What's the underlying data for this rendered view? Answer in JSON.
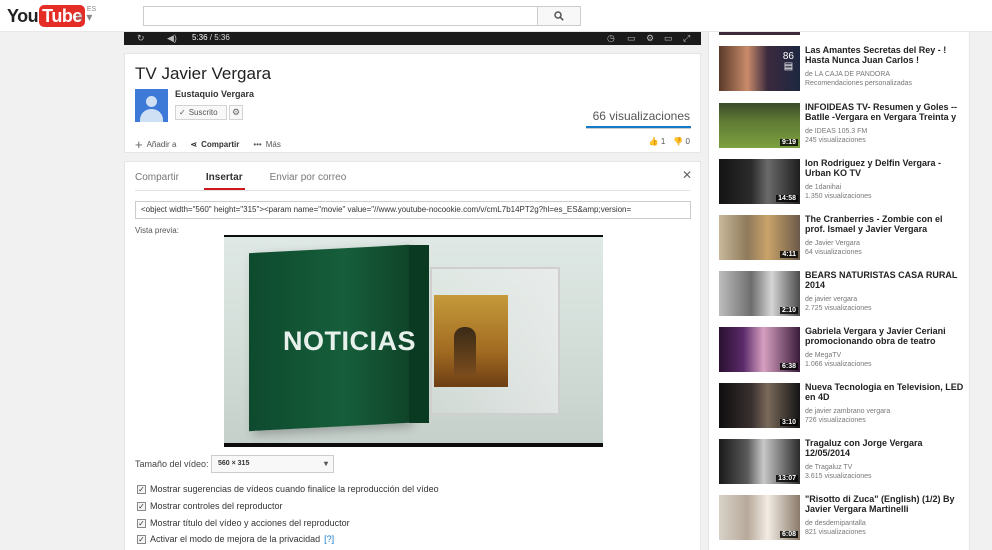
{
  "header": {
    "logo_you": "You",
    "logo_tube": "Tube",
    "logo_country": "ES"
  },
  "player": {
    "time_current": "5:36",
    "time_total": " / 5:36"
  },
  "video": {
    "title": "TV Javier Vergara",
    "channel": "Eustaquio Vergara",
    "subscribe_label": "Suscrito",
    "views": "66 visualizaciones",
    "actions": {
      "add_to": "Añadir a",
      "share": "Compartir",
      "more": "Más"
    },
    "likes": "1",
    "dislikes": "0"
  },
  "share_panel": {
    "tabs": [
      "Compartir",
      "Insertar",
      "Enviar por correo"
    ],
    "active_tab": "Insertar",
    "embed_code": "<object width=\"560\" height=\"315\"><param name=\"movie\" value=\"//www.youtube-nocookie.com/v/cmL7b14PT2g?hl=es_ES&amp;version=",
    "preview_label": "Vista previa:",
    "preview_overlay_text": "NOTICIAS",
    "size_label": "Tamaño del vídeo:",
    "size_value": "560 × 315",
    "options": [
      {
        "label": "Mostrar sugerencias de vídeos cuando finalice la reproducción del vídeo",
        "checked": true
      },
      {
        "label": "Mostrar controles del reproductor",
        "checked": true
      },
      {
        "label": "Mostrar título del vídeo y acciones del reproductor",
        "checked": true
      },
      {
        "label": "Activar el modo de mejora de la privacidad",
        "checked": true,
        "help": "[?]"
      }
    ]
  },
  "sidebar": {
    "items": [
      {
        "title": "Las Amantes Secretas del Rey - ! Hasta Nunca Juan Carlos !",
        "meta1": "de LA CAJA DE PANDORA",
        "meta2": "Recomendaciones personalizadas",
        "duration": "",
        "badge": "86"
      },
      {
        "title": "INFOIDEAS TV- Resumen y Goles -- Batlle -Vergara en Vergara Treinta y",
        "meta1": "de IDEAS 105.3 FM",
        "meta2": "245 visualizaciones",
        "duration": "9:19"
      },
      {
        "title": "Ion Rodriguez y Delfin Vergara - Urban KO TV",
        "meta1": "de 1danihai",
        "meta2": "1.350 visualizaciones",
        "duration": "14:58"
      },
      {
        "title": "The Cranberries - Zombie con el prof. Ismael y Javier Vergara",
        "meta1": "de Javier Vergara",
        "meta2": "64 visualizaciones",
        "duration": "4:11"
      },
      {
        "title": "BEARS NATURISTAS CASA RURAL 2014",
        "meta1": "de javier vergara",
        "meta2": "2.725 visualizaciones",
        "duration": "2:10"
      },
      {
        "title": "Gabriela Vergara y Javier Ceriani promocionando obra de teatro",
        "meta1": "de MegaTV",
        "meta2": "1.066 visualizaciones",
        "duration": "6:38"
      },
      {
        "title": "Nueva Tecnologia en Television, LED en 4D",
        "meta1": "de javier zambrano vergara",
        "meta2": "726 visualizaciones",
        "duration": "3:10"
      },
      {
        "title": "Tragaluz con Jorge Vergara 12/05/2014",
        "meta1": "de Tragaluz TV",
        "meta2": "3.615 visualizaciones",
        "duration": "13:07"
      },
      {
        "title": "\"Risotto di Zuca\" (English) (1/2) By Javier Vergara Martinelli",
        "meta1": "de desdemipantalla",
        "meta2": "821 visualizaciones",
        "duration": "6:08"
      }
    ]
  },
  "colors": {
    "brand_red": "#e52d27",
    "link_blue": "#167ac6"
  }
}
